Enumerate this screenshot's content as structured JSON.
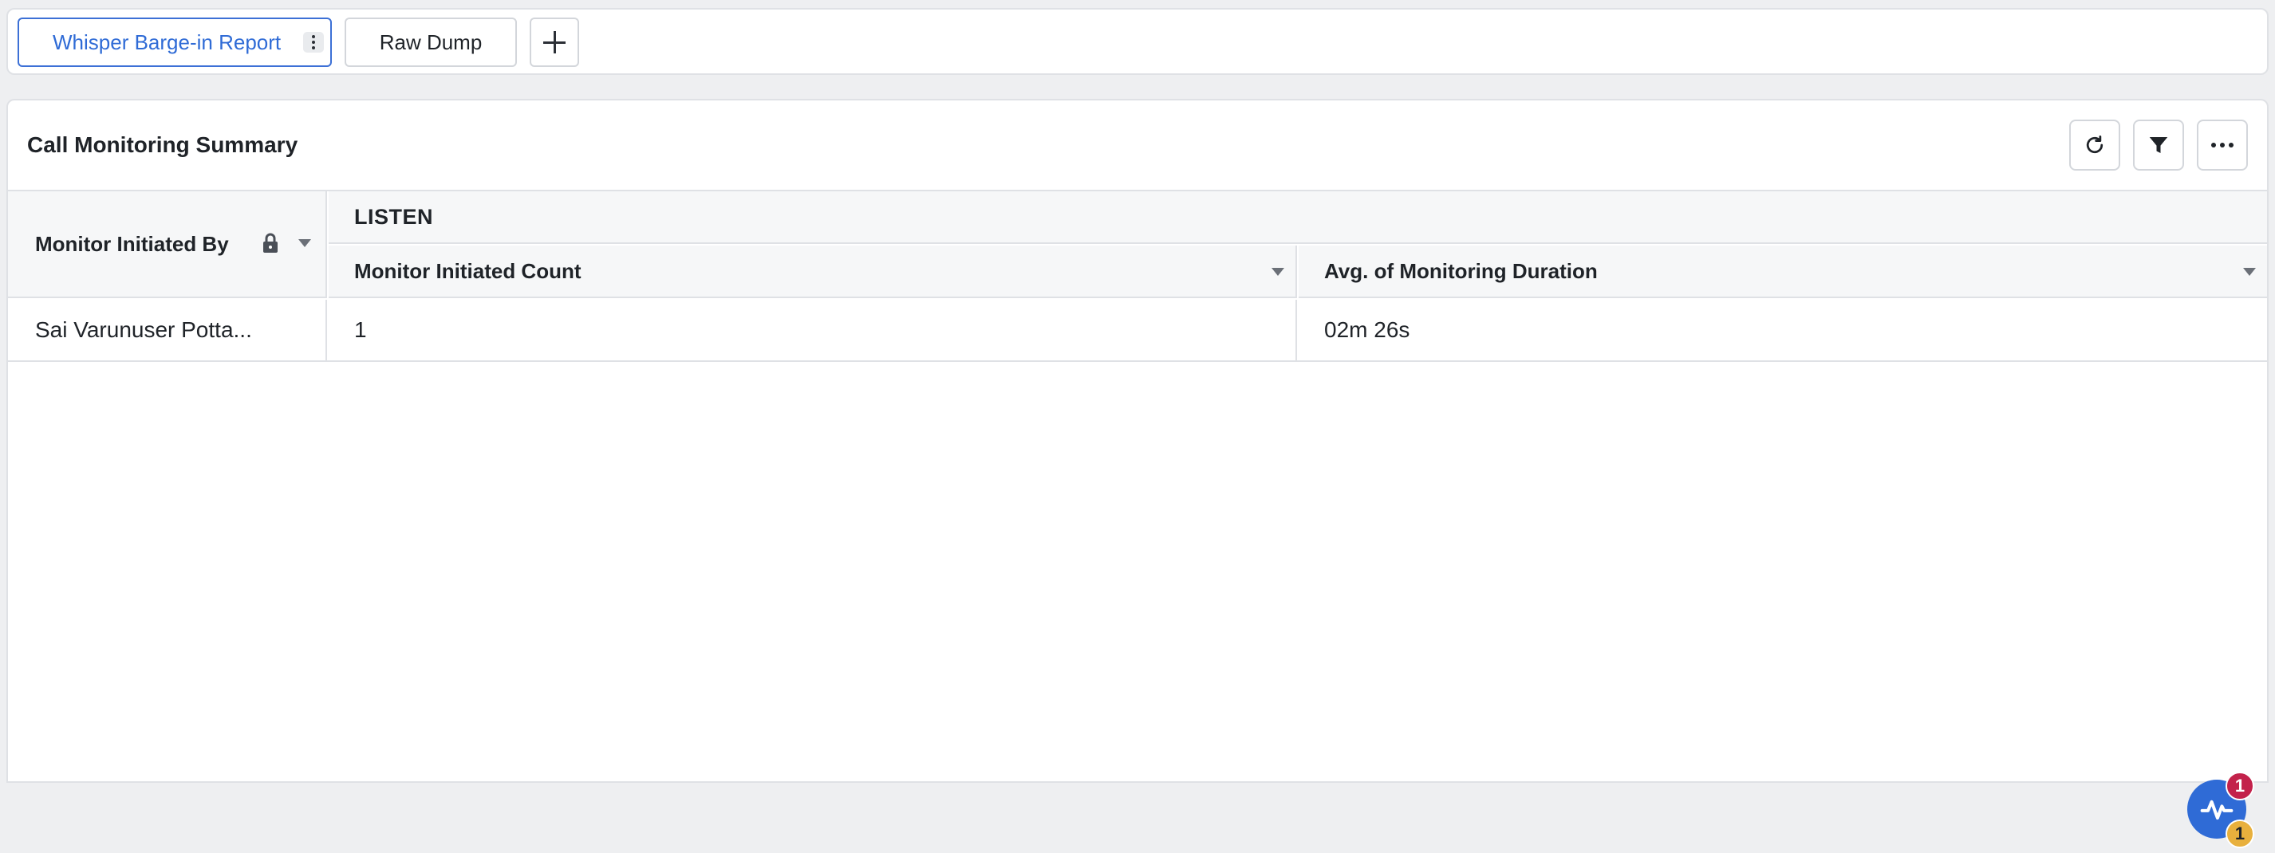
{
  "tabs": [
    {
      "label": "Whisper Barge-in Report",
      "active": true
    },
    {
      "label": "Raw Dump",
      "active": false
    }
  ],
  "add_tab_icon": "plus-icon",
  "widget": {
    "title": "Call Monitoring Summary",
    "toolbar": [
      "refresh-icon",
      "filter-icon",
      "more-icon"
    ]
  },
  "table": {
    "row_header": "Monitor Initiated By",
    "group_header": "LISTEN",
    "columns": [
      "Monitor Initiated Count",
      "Avg. of Monitoring Duration"
    ],
    "rows": [
      {
        "monitor_initiated_by": "Sai Varunuser Pottabathini",
        "count": "1",
        "avg_duration": "02m 26s"
      }
    ]
  },
  "notifications": {
    "top_badge": "1",
    "bottom_badge": "1"
  },
  "colors": {
    "accent": "#2f6bd6",
    "badge_red": "#c3224b",
    "badge_yellow": "#e8b03d"
  }
}
